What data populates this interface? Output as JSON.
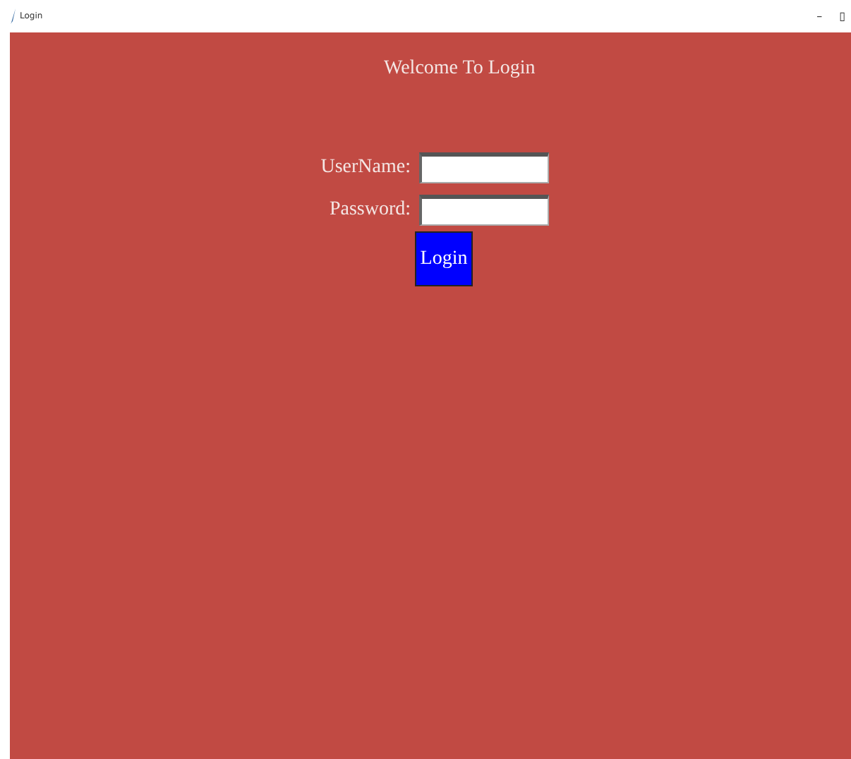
{
  "window": {
    "title": "Login",
    "controls": [
      "–",
      "▯"
    ]
  },
  "heading": "Welcome To Login",
  "fields": [
    {
      "label": "UserName:"
    },
    {
      "label": "Password:"
    }
  ],
  "button": "Login"
}
